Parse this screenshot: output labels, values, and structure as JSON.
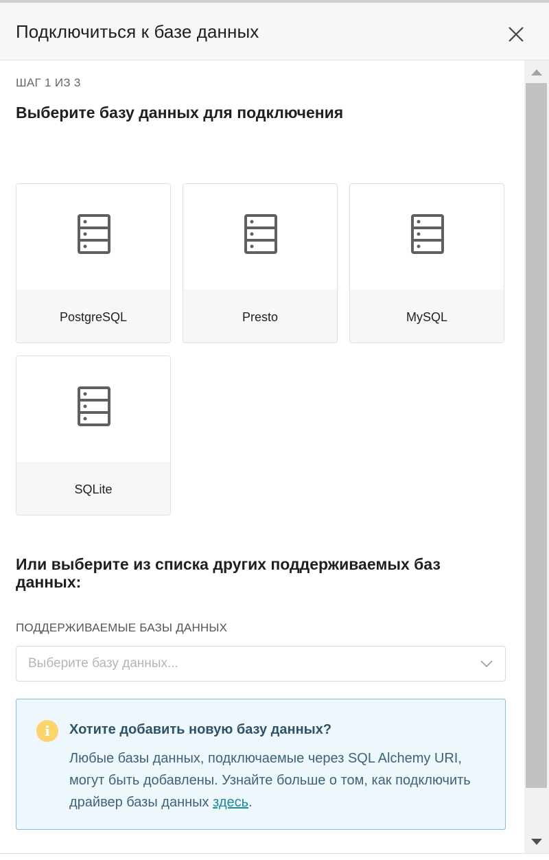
{
  "modal": {
    "title": "Подключиться к базе данных",
    "close_icon": "close-icon"
  },
  "step_label": "ШАГ 1 ИЗ 3",
  "heading": "Выберите базу данных для подключения",
  "databases": [
    {
      "label": "PostgreSQL",
      "icon": "database-icon"
    },
    {
      "label": "Presto",
      "icon": "database-icon"
    },
    {
      "label": "MySQL",
      "icon": "database-icon"
    },
    {
      "label": "SQLite",
      "icon": "database-icon"
    }
  ],
  "other": {
    "heading": "Или выберите из списка других поддерживаемых баз данных:",
    "field_label": "ПОДДЕРЖИВАЕМЫЕ БАЗЫ ДАННЫХ",
    "select_placeholder": "Выберите базу данных..."
  },
  "info": {
    "title": "Хотите добавить новую базу данных?",
    "text": "Любые базы данных, подключаемые через SQL Alchemy URI, могут быть добавлены. Узнайте больше о том, как подключить драйвер базы данных ",
    "link": "здесь",
    "suffix": ".",
    "icon_glyph": "i"
  },
  "colors": {
    "info_bg": "#eef7fc",
    "info_border": "#7fc0dd",
    "info_icon": "#fbd46b",
    "link": "#1a8a9c"
  }
}
